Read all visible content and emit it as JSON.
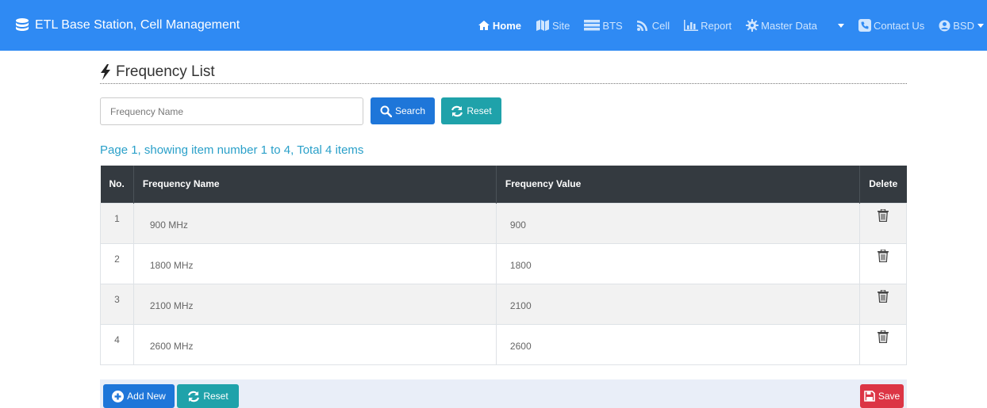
{
  "navbar": {
    "brand": "ETL Base Station, Cell Management",
    "items": [
      {
        "label": "Home",
        "icon": "home-icon"
      },
      {
        "label": "Site",
        "icon": "map-icon"
      },
      {
        "label": "BTS",
        "icon": "server-icon"
      },
      {
        "label": "Cell",
        "icon": "rss-icon"
      },
      {
        "label": "Report",
        "icon": "bar-chart-icon"
      },
      {
        "label": "Master Data",
        "icon": "gear-icon"
      },
      {
        "label": "Contact Us",
        "icon": "phone-icon"
      },
      {
        "label": "BSD",
        "icon": "user-circle-icon"
      }
    ]
  },
  "page": {
    "title": "Frequency List"
  },
  "search": {
    "placeholder": "Frequency Name",
    "search_label": "Search",
    "reset_label": "Reset"
  },
  "pagination": {
    "info": "Page 1, showing item number 1 to 4, Total 4 items"
  },
  "table": {
    "headers": [
      "No.",
      "Frequency Name",
      "Frequency Value",
      "Delete"
    ],
    "rows": [
      {
        "no": "1",
        "name": "900 MHz",
        "value": "900"
      },
      {
        "no": "2",
        "name": "1800 MHz",
        "value": "1800"
      },
      {
        "no": "3",
        "name": "2100 MHz",
        "value": "2100"
      },
      {
        "no": "4",
        "name": "2600 MHz",
        "value": "2600"
      }
    ]
  },
  "footer": {
    "add_label": "Add New",
    "reset_label": "Reset",
    "save_label": "Save"
  },
  "colors": {
    "navbar": "#2f8af3",
    "primary": "#1e76d9",
    "info": "#1fa2aa",
    "danger": "#dc3545",
    "table_header": "#343a40"
  }
}
